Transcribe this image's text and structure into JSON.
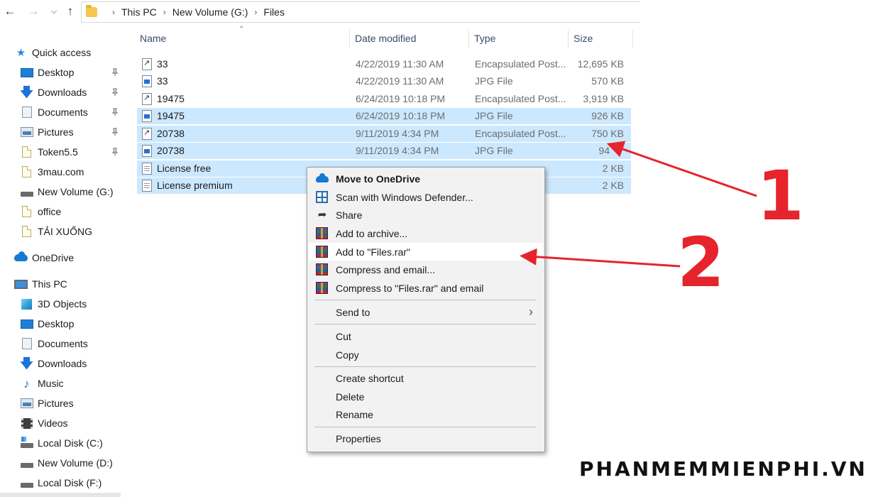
{
  "breadcrumb": [
    "This PC",
    "New Volume (G:)",
    "Files"
  ],
  "sidebar": {
    "items": [
      {
        "label": "Quick access",
        "icon": "star-icon",
        "pinned": false
      },
      {
        "label": "Desktop",
        "icon": "desktop-icon",
        "pinned": true
      },
      {
        "label": "Downloads",
        "icon": "download-arrow-icon",
        "pinned": true
      },
      {
        "label": "Documents",
        "icon": "documents-icon",
        "pinned": true
      },
      {
        "label": "Pictures",
        "icon": "pictures-icon",
        "pinned": true
      },
      {
        "label": "Token5.5",
        "icon": "folder-icon",
        "pinned": true
      },
      {
        "label": "3mau.com",
        "icon": "folder-icon",
        "pinned": false
      },
      {
        "label": "New Volume (G:)",
        "icon": "drive-icon",
        "pinned": false
      },
      {
        "label": "office",
        "icon": "folder-icon",
        "pinned": false
      },
      {
        "label": "TẢI XUỐNG",
        "icon": "folder-icon",
        "pinned": false
      },
      {
        "label": "OneDrive",
        "icon": "onedrive-icon",
        "pinned": false
      },
      {
        "label": "This PC",
        "icon": "computer-icon",
        "pinned": false
      },
      {
        "label": "3D Objects",
        "icon": "3d-objects-icon",
        "pinned": false
      },
      {
        "label": "Desktop",
        "icon": "desktop-icon",
        "pinned": false
      },
      {
        "label": "Documents",
        "icon": "documents-icon",
        "pinned": false
      },
      {
        "label": "Downloads",
        "icon": "download-arrow-icon",
        "pinned": false
      },
      {
        "label": "Music",
        "icon": "music-note-icon",
        "pinned": false
      },
      {
        "label": "Pictures",
        "icon": "pictures-icon",
        "pinned": false
      },
      {
        "label": "Videos",
        "icon": "videos-icon",
        "pinned": false
      },
      {
        "label": "Local Disk (C:)",
        "icon": "system-drive-icon",
        "pinned": false
      },
      {
        "label": "New Volume (D:)",
        "icon": "drive-icon",
        "pinned": false
      },
      {
        "label": "Local Disk (F:)",
        "icon": "drive-icon",
        "pinned": false
      }
    ]
  },
  "columns": {
    "name": "Name",
    "date": "Date modified",
    "type": "Type",
    "size": "Size"
  },
  "files": [
    {
      "name": "33",
      "date": "4/22/2019 11:30 AM",
      "type": "Encapsulated Post...",
      "size": "12,695 KB",
      "icon": "eps-file-icon",
      "selected": false
    },
    {
      "name": "33",
      "date": "4/22/2019 11:30 AM",
      "type": "JPG File",
      "size": "570 KB",
      "icon": "jpg-file-icon",
      "selected": false
    },
    {
      "name": "19475",
      "date": "6/24/2019 10:18 PM",
      "type": "Encapsulated Post...",
      "size": "3,919 KB",
      "icon": "eps-file-icon",
      "selected": false
    },
    {
      "name": "19475",
      "date": "6/24/2019 10:18 PM",
      "type": "JPG File",
      "size": "926 KB",
      "icon": "jpg-file-icon",
      "selected": true
    },
    {
      "name": "20738",
      "date": "9/11/2019 4:34 PM",
      "type": "Encapsulated Post...",
      "size": "750 KB",
      "icon": "eps-file-icon",
      "selected": true
    },
    {
      "name": "20738",
      "date": "9/11/2019 4:34 PM",
      "type": "JPG File",
      "size": "94",
      "icon": "jpg-file-icon",
      "selected": true
    },
    {
      "name": "License free",
      "date": "",
      "type": "",
      "size": "2 KB",
      "icon": "text-file-icon",
      "selected": true
    },
    {
      "name": "License premium",
      "date": "",
      "type": "",
      "size": "2 KB",
      "icon": "text-file-icon",
      "selected": true
    }
  ],
  "context_menu": {
    "items": [
      {
        "label": "Move to OneDrive",
        "icon": "onedrive-icon",
        "bold": true
      },
      {
        "label": "Scan with Windows Defender...",
        "icon": "defender-icon"
      },
      {
        "label": "Share",
        "icon": "share-icon"
      },
      {
        "label": "Add to archive...",
        "icon": "winrar-icon"
      },
      {
        "label": "Add to \"Files.rar\"",
        "icon": "winrar-icon",
        "highlighted": true
      },
      {
        "label": "Compress and email...",
        "icon": "winrar-icon"
      },
      {
        "label": "Compress to \"Files.rar\" and email",
        "icon": "winrar-icon"
      },
      {
        "label": "Send to",
        "submenu": true
      },
      {
        "label": "Cut"
      },
      {
        "label": "Copy"
      },
      {
        "label": "Create shortcut"
      },
      {
        "label": "Delete"
      },
      {
        "label": "Rename"
      },
      {
        "label": "Properties"
      }
    ]
  },
  "annotations": {
    "step1": "1",
    "step2": "2",
    "arrow_color": "#e6242b"
  },
  "watermark": "PHANMEMMIENPHI.VN",
  "colors": {
    "selection": "#cce8ff",
    "menu_bg": "#f2f2f2",
    "accent": "#1979d2"
  }
}
